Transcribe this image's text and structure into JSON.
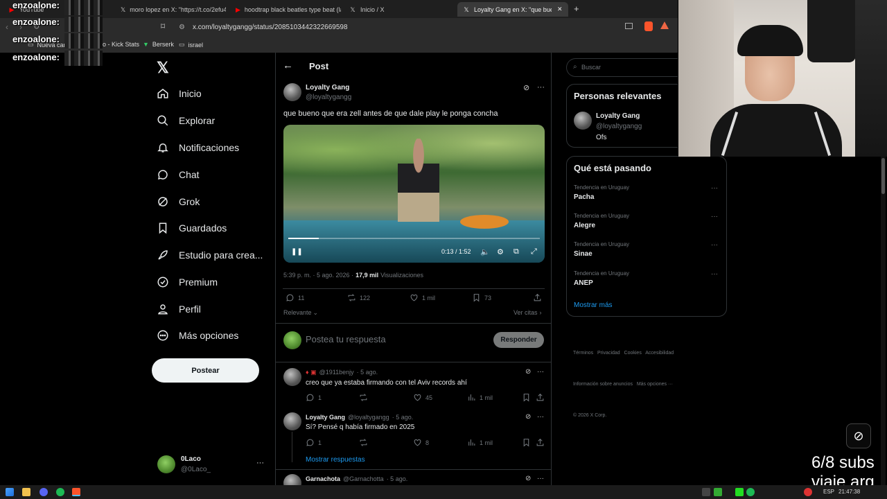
{
  "browser": {
    "tabs": [
      {
        "label": "YouTube",
        "favicon": "youtube-icon"
      },
      {
        "label": "moro lopez en X: \"https://t.co/2efu4l",
        "favicon": "x-icon"
      },
      {
        "label": "hoodtrap black beatles type beat (la",
        "favicon": "youtube-icon"
      },
      {
        "label": "Inicio / X",
        "favicon": "x-icon"
      },
      {
        "label": "Loyalty Gang en X: \"que buen",
        "favicon": "x-icon",
        "active": true
      }
    ],
    "url": "x.com/loyaltygangg/status/2085103442322669598",
    "bookmarks": [
      "Nueva car",
      "o - Kick Stats",
      "Berserk",
      "israel"
    ]
  },
  "overlay": {
    "usernames": [
      "enzoalone:",
      "enzoalone:",
      "enzoalone:",
      "enzoalone:"
    ]
  },
  "nav": {
    "items": [
      "Inicio",
      "Explorar",
      "Notificaciones",
      "Chat",
      "Grok",
      "Guardados",
      "Estudio para crea...",
      "Premium",
      "Perfil",
      "Más opciones"
    ],
    "post_label": "Postear",
    "account_name": "0Laco",
    "account_handle": "@0Laco_"
  },
  "post": {
    "header": "Post",
    "author": "Loyalty Gang",
    "handle": "@loyaltygangg",
    "text": "que bueno que era zell antes de que dale play le ponga concha",
    "video_time": "0:13 / 1:52",
    "video_progress": 0.12,
    "meta_time": "5:39 p. m. · 5 ago. 2026 ·",
    "views": "17,9 mil",
    "views_label": "Visualizaciones",
    "replies": "11",
    "reposts": "122",
    "likes": "1 mil",
    "bookmarks": "73",
    "sort_label": "Relevante",
    "quotes_label": "Ver citas",
    "reply_placeholder": "Postea tu respuesta",
    "reply_button": "Responder"
  },
  "replies": [
    {
      "name": "",
      "handle": "@1911benjy",
      "date": "· 5 ago.",
      "text": "creo que ya estaba firmando con tel Aviv records ahí",
      "replies": "1",
      "reposts": "",
      "likes": "45",
      "views": "1 mil"
    },
    {
      "name": "Loyalty Gang",
      "handle": "@loyaltygangg",
      "date": "· 5 ago.",
      "text": "Sí? Pensé q había firmado en 2025",
      "replies": "1",
      "reposts": "",
      "likes": "8",
      "views": "1 mil"
    },
    {
      "name": "Garnachota",
      "handle": "@Garnachotta",
      "date": "· 5 ago.",
      "text": ""
    }
  ],
  "show_replies": "Mostrar respuestas",
  "sidebar": {
    "search_placeholder": "Buscar",
    "relevant_title": "Personas relevantes",
    "relevant_name": "Loyalty Gang",
    "relevant_handle": "@loyaltygangg",
    "relevant_bio": "Ofs",
    "trends_title": "Qué está pasando",
    "trends": [
      {
        "category": "Tendencia en Uruguay",
        "name": "Pacha"
      },
      {
        "category": "Tendencia en Uruguay",
        "name": "Alegre"
      },
      {
        "category": "Tendencia en Uruguay",
        "name": "Sinae"
      },
      {
        "category": "Tendencia en Uruguay",
        "name": "ANEP"
      }
    ],
    "show_more": "Mostrar más",
    "footer_line1": "Términos   Privacidad   Cookies   Accesibilidad",
    "footer_line2": "Información sobre anuncios   Más opciones ···",
    "footer_line3": "© 2026 X Corp."
  },
  "stream_overlay": {
    "line1": "6/8 subs",
    "line2": "viaje arg"
  },
  "taskbar": {
    "lang": "ESP",
    "time": "21:47:38"
  },
  "colors": {
    "accent": "#1d9bf0",
    "background": "#000000",
    "border": "#2f3336",
    "muted": "#71767b"
  }
}
